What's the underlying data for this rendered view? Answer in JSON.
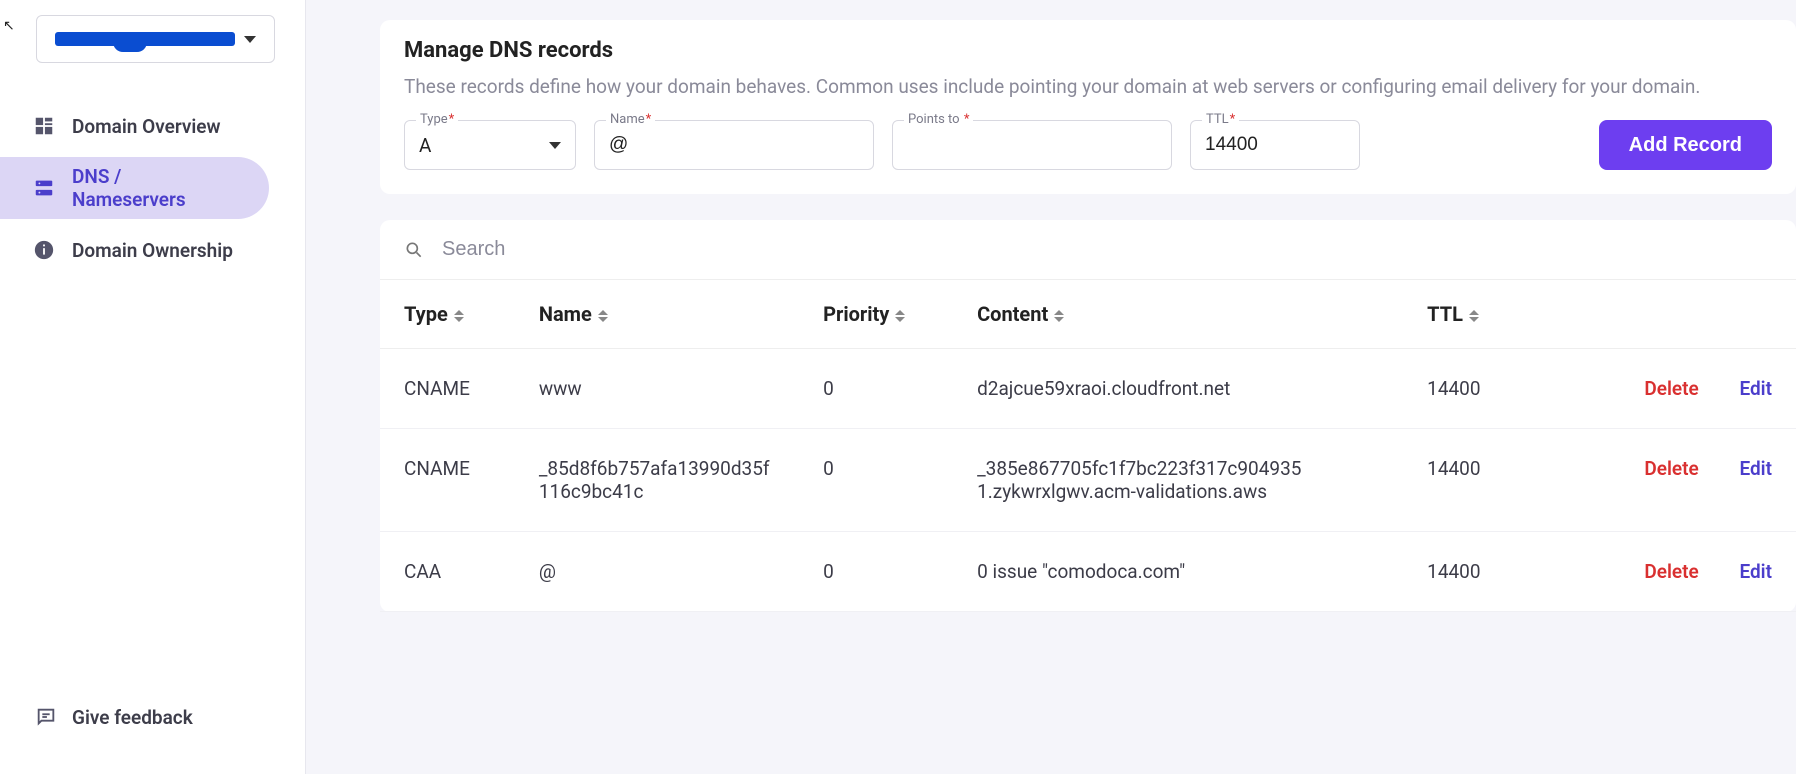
{
  "sidebar": {
    "domain_placeholder": "(redacted)",
    "items": [
      {
        "label": "Domain Overview"
      },
      {
        "label": "DNS / Nameservers"
      },
      {
        "label": "Domain Ownership"
      }
    ],
    "feedback_label": "Give feedback"
  },
  "manage": {
    "title": "Manage DNS records",
    "desc": "These records define how your domain behaves. Common uses include pointing your domain at web servers or configuring email delivery for your domain.",
    "labels": {
      "type": "Type",
      "name": "Name",
      "points": "Points to",
      "ttl": "TTL"
    },
    "values": {
      "type": "A",
      "name": "@",
      "points": "",
      "ttl": "14400"
    },
    "add_button": "Add Record"
  },
  "search": {
    "placeholder": "Search"
  },
  "columns": {
    "type": "Type",
    "name": "Name",
    "priority": "Priority",
    "content": "Content",
    "ttl": "TTL"
  },
  "actions": {
    "delete": "Delete",
    "edit": "Edit"
  },
  "rows": [
    {
      "type": "CNAME",
      "name": "www",
      "priority": "0",
      "content": "d2ajcue59xraoi.cloudfront.net",
      "ttl": "14400"
    },
    {
      "type": "CNAME",
      "name": "_85d8f6b757afa13990d35f116c9bc41c",
      "priority": "0",
      "content": "_385e867705fc1f7bc223f317c9049351.zykwrxlgwv.acm-validations.aws",
      "ttl": "14400"
    },
    {
      "type": "CAA",
      "name": "@",
      "priority": "0",
      "content": "0 issue \"comodoca.com\"",
      "ttl": "14400"
    }
  ]
}
